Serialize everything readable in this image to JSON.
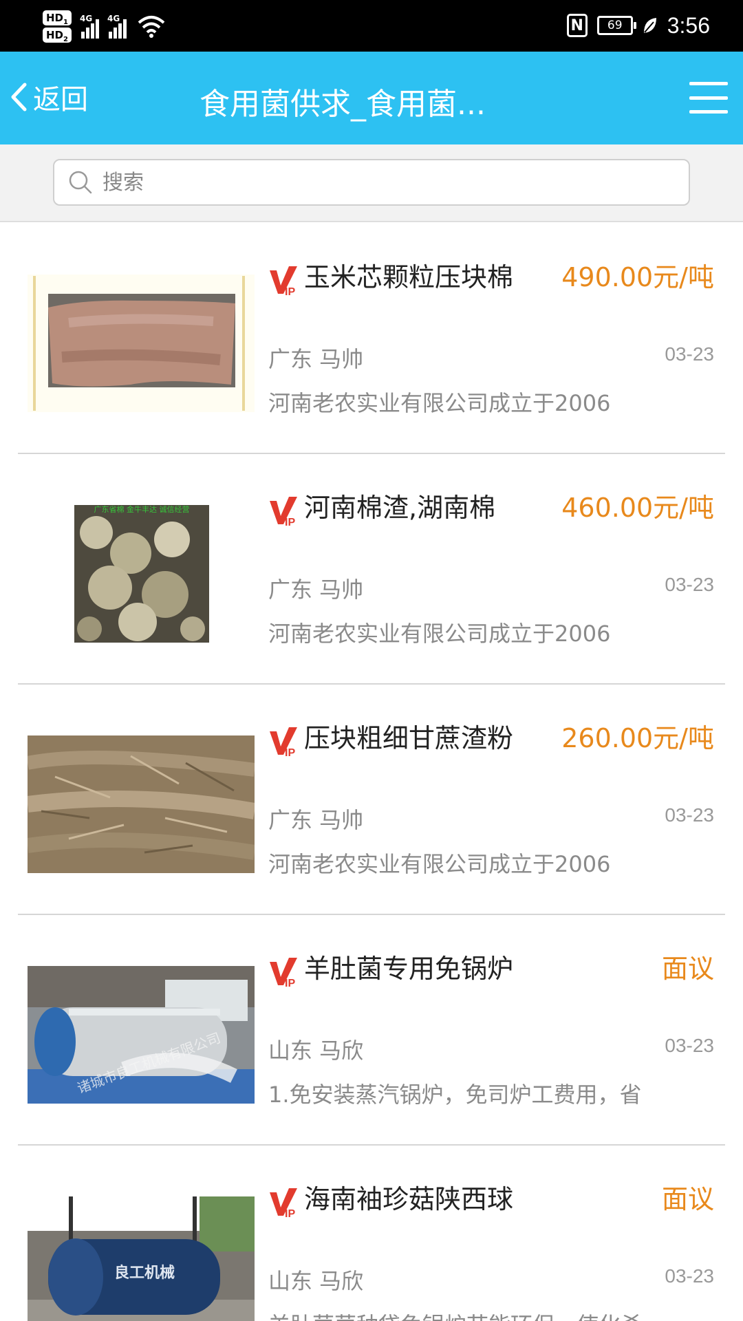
{
  "status_bar": {
    "hd1": "HD",
    "hd1_sub": "1",
    "hd2": "HD",
    "hd2_sub": "2",
    "net1": "4G",
    "net2": "4G",
    "nfc": "N",
    "battery": "69",
    "time": "3:56"
  },
  "nav": {
    "back_label": "返回",
    "title": "食用菌供求_食用菌..."
  },
  "search": {
    "placeholder": "搜索",
    "value": ""
  },
  "colors": {
    "nav_bg": "#2dc1f2",
    "price": "#e8891c",
    "vip_red": "#e23b2e"
  },
  "items": [
    {
      "title": "玉米芯颗粒压块棉",
      "price": "490.00元/吨",
      "location": "广东  马帅",
      "date": "03-23",
      "desc": "河南老农实业有限公司成立于2006"
    },
    {
      "title": "河南棉渣,湖南棉",
      "price": "460.00元/吨",
      "location": "广东  马帅",
      "date": "03-23",
      "desc": "河南老农实业有限公司成立于2006",
      "banner": "广东省棉    金牛丰达    诚信经营"
    },
    {
      "title": "压块粗细甘蔗渣粉",
      "price": "260.00元/吨",
      "location": "广东  马帅",
      "date": "03-23",
      "desc": "河南老农实业有限公司成立于2006"
    },
    {
      "title": "羊肚菌专用免锅炉",
      "price": "面议",
      "location": "山东  马欣",
      "date": "03-23",
      "desc": "1.免安装蒸汽锅炉，免司炉工费用，省",
      "watermark": "诸城市良工机械有限公司"
    },
    {
      "title": "海南袖珍菇陕西球",
      "price": "面议",
      "location": "山东  马欣",
      "date": "03-23",
      "desc": "羊肚菌菌种袋免锅炉节能环保，使化杀",
      "logo": "良工机械"
    }
  ]
}
